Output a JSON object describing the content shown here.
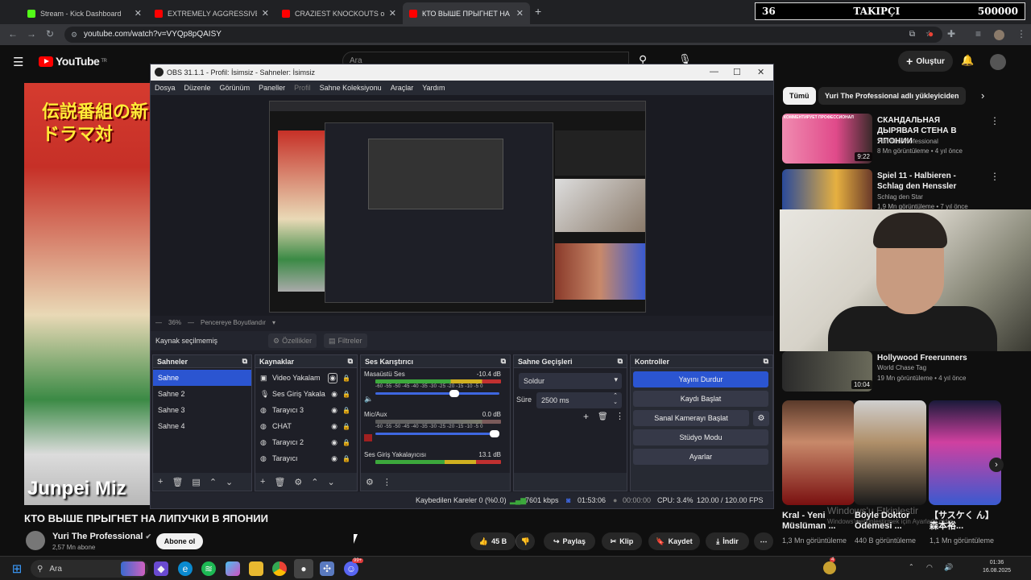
{
  "browser": {
    "tabs": [
      {
        "title": "Stream - Kick Dashboard",
        "color": "#53fc18"
      },
      {
        "title": "EXTREMELY AGGRESSIVE & HIG",
        "color": "#ff0000"
      },
      {
        "title": "CRAZIEST KNOCKOUTS of 2023",
        "color": "#ff0000"
      },
      {
        "title": "КТО ВЫШЕ ПРЫГНЕТ НА ЛИПУ",
        "color": "#ff0000"
      }
    ],
    "new_tab": "+",
    "url": "youtube.com/watch?v=VYQp8pQAISY"
  },
  "follow_overlay": {
    "current": "36",
    "label": "TAKIPÇI",
    "goal": "500000"
  },
  "youtube": {
    "logo": "YouTube",
    "logo_region": "TR",
    "search_placeholder": "Ara",
    "create": "Oluştur",
    "video_caption": "Junpei Miz",
    "video_jp_title": "伝説番組の新ドラマ対",
    "video_title": "КТО ВЫШЕ ПРЫГНЕТ НА ЛИПУЧКИ В ЯПОНИИ",
    "channel_name": "Yuri The Professional",
    "channel_subs": "2,57 Mn abone",
    "subscribe": "Abone ol",
    "actions": {
      "like_count": "45 B",
      "share": "Paylaş",
      "clip": "Klip",
      "save": "Kaydet",
      "download": "İndir"
    },
    "chips": [
      "Tümü",
      "Yuri The Professional adlı yükleyiciden"
    ],
    "recommendations": [
      {
        "title": "СКАНДАЛЬНАЯ ДЫРЯВАЯ СТЕНА В ЯПОНИИ",
        "channel": "Yuri The Professional",
        "meta": "8 Mn görüntüleme • 4 yıl önce",
        "duration": "9:22",
        "thumb_overlay": "КОММЕНТИРУЕТ ПРОФЕССИОНАЛ"
      },
      {
        "title": "Spiel 11 - Halbieren - Schlag den Henssler",
        "channel": "Schlag den Star",
        "meta": "1,9 Mn görüntüleme • 7 yıl önce",
        "duration": "",
        "thumb_overlay": ""
      },
      {
        "title": "Hollywood Freerunners",
        "channel": "World Chase Tag",
        "meta": "19 Mn görüntüleme • 4 yıl önce",
        "duration": "10:04",
        "thumb_overlay": ""
      }
    ],
    "shorts": [
      {
        "title": "Kral - Yeni Müslüman ...",
        "views": "1,3 Mn görüntüleme"
      },
      {
        "title": "Böyle Doktor Ödemesi ...",
        "views": "440 B görüntüleme"
      },
      {
        "title": "【サスケく ん】森本裕...",
        "views": "1,1 Mn görüntüleme"
      }
    ]
  },
  "obs": {
    "title": "OBS 31.1.1 - Profil: İsimsiz - Sahneler: İsimsiz",
    "menu": [
      "Dosya",
      "Düzenle",
      "Görünüm",
      "Paneller",
      "Profil",
      "Sahne Koleksiyonu",
      "Araçlar",
      "Yardım"
    ],
    "zoom": "36%",
    "fit": "Pencereye Boyutlandır",
    "no_source": "Kaynak seçilmemiş",
    "properties": "Özellikler",
    "filters": "Filtreler",
    "scenes_title": "Sahneler",
    "scenes": [
      "Sahne",
      "Sahne 2",
      "Sahne 3",
      "Sahne 4"
    ],
    "sources_title": "Kaynaklar",
    "sources": [
      {
        "name": "Video Yakalam",
        "icon": "camera-icon"
      },
      {
        "name": "Ses Giriş Yakala",
        "icon": "microphone-icon"
      },
      {
        "name": "Tarayıcı 3",
        "icon": "globe-icon"
      },
      {
        "name": "CHAT",
        "icon": "globe-icon"
      },
      {
        "name": "Tarayıcı 2",
        "icon": "globe-icon"
      },
      {
        "name": "Tarayıcı",
        "icon": "globe-icon"
      }
    ],
    "mixer_title": "Ses Karıştırıcı",
    "mixer": [
      {
        "name": "Masaüstü Ses",
        "db": "-10.4 dB"
      },
      {
        "name": "Mic/Aux",
        "db": "0.0 dB"
      },
      {
        "name": "Ses Giriş Yakalayıcısı",
        "db": "13.1 dB"
      }
    ],
    "meter_scale": "-60 -55 -50 -45 -40 -35 -30 -25 -20 -15 -10 -5 0",
    "transitions_title": "Sahne Geçişleri",
    "transition": "Soldur",
    "duration_label": "Süre",
    "duration": "2500 ms",
    "controls_title": "Kontroller",
    "controls": [
      "Yayını Durdur",
      "Kaydı Başlat",
      "Sanal Kamerayı Başlat",
      "Stüdyo Modu",
      "Ayarlar"
    ],
    "status": {
      "dropped": "Kaybedilen Kareler 0 (%0.0)",
      "bitrate": "7601 kbps",
      "stream_time": "01:53:06",
      "record_time": "00:00:00",
      "cpu": "CPU: 3.4%",
      "fps": "120.00 / 120.00 FPS"
    }
  },
  "windows": {
    "watermark_line1": "Windows'u Etkinleştir",
    "watermark_line2": "Windows'u etkinleştirmek için Ayarlar'a gidin.",
    "search": "Ara",
    "clock_time": "01:36",
    "clock_date": "16.08.2025",
    "notif_badge": "4",
    "discord_badge": "99+"
  },
  "colors": {
    "accent": "#2b55d1",
    "youtube_red": "#ff0000",
    "kick_green": "#53fc18"
  }
}
